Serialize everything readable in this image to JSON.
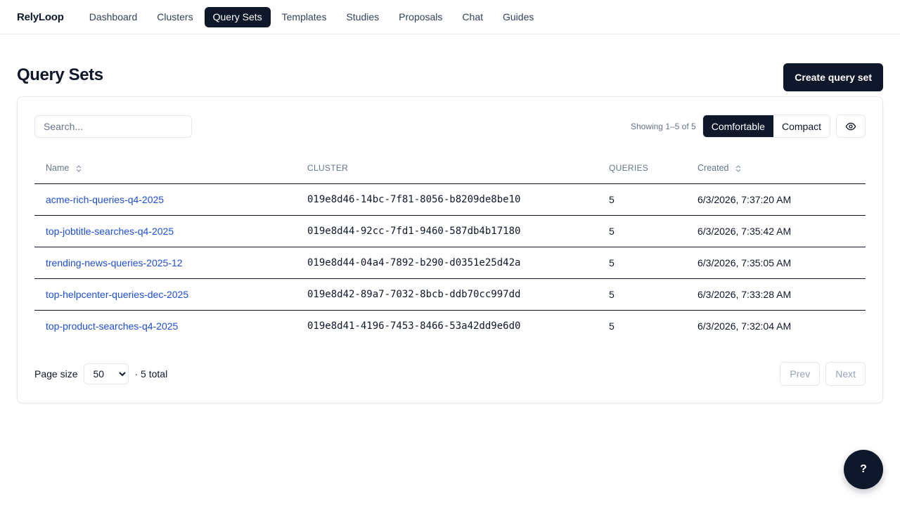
{
  "brand": "RelyLoop",
  "nav": [
    {
      "label": "Dashboard",
      "active": false
    },
    {
      "label": "Clusters",
      "active": false
    },
    {
      "label": "Query Sets",
      "active": true
    },
    {
      "label": "Templates",
      "active": false
    },
    {
      "label": "Studies",
      "active": false
    },
    {
      "label": "Proposals",
      "active": false
    },
    {
      "label": "Chat",
      "active": false
    },
    {
      "label": "Guides",
      "active": false
    }
  ],
  "page": {
    "title": "Query Sets",
    "create_label": "Create query set"
  },
  "toolbar": {
    "search_placeholder": "Search...",
    "showing": "Showing 1–5 of 5",
    "density": [
      "Comfortable",
      "Compact"
    ],
    "density_selected": "Comfortable",
    "columns_icon": "eye-icon"
  },
  "table": {
    "headers": {
      "name": "Name",
      "cluster": "CLUSTER",
      "queries": "QUERIES",
      "created": "Created"
    },
    "rows": [
      {
        "name": "acme-rich-queries-q4-2025",
        "cluster": "019e8d46-14bc-7f81-8056-b8209de8be10",
        "queries": "5",
        "created": "6/3/2026, 7:37:20 AM"
      },
      {
        "name": "top-jobtitle-searches-q4-2025",
        "cluster": "019e8d44-92cc-7fd1-9460-587db4b17180",
        "queries": "5",
        "created": "6/3/2026, 7:35:42 AM"
      },
      {
        "name": "trending-news-queries-2025-12",
        "cluster": "019e8d44-04a4-7892-b290-d0351e25d42a",
        "queries": "5",
        "created": "6/3/2026, 7:35:05 AM"
      },
      {
        "name": "top-helpcenter-queries-dec-2025",
        "cluster": "019e8d42-89a7-7032-8bcb-ddb70cc997dd",
        "queries": "5",
        "created": "6/3/2026, 7:33:28 AM"
      },
      {
        "name": "top-product-searches-q4-2025",
        "cluster": "019e8d41-4196-7453-8466-53a42dd9e6d0",
        "queries": "5",
        "created": "6/3/2026, 7:32:04 AM"
      }
    ]
  },
  "footer": {
    "page_size_label": "Page size",
    "page_size_value": "50",
    "total": "· 5 total",
    "prev": "Prev",
    "next": "Next"
  },
  "help": {
    "label": "?"
  },
  "colors": {
    "primary": "#0f172a",
    "link": "#1d4ed8",
    "muted": "#64748b"
  }
}
